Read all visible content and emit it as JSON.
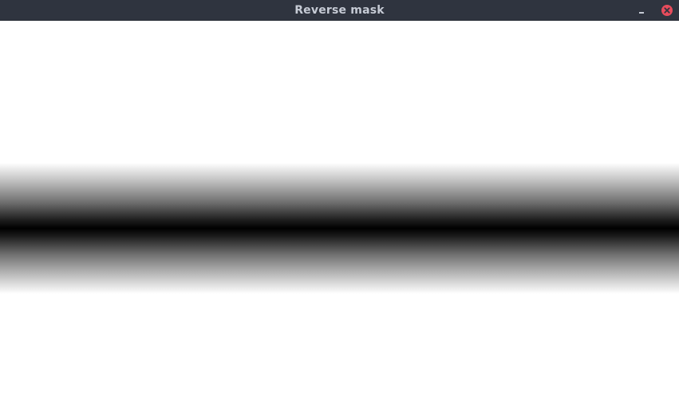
{
  "window": {
    "title": "Reverse mask",
    "minimize_icon": "minimize-icon",
    "close_icon": "close-icon",
    "titlebar_color": "#2f343f",
    "close_color": "#e74c5c"
  },
  "content": {
    "background": "#ffffff",
    "band_center_color": "#000000",
    "band_edge_color": "#ffffff"
  }
}
